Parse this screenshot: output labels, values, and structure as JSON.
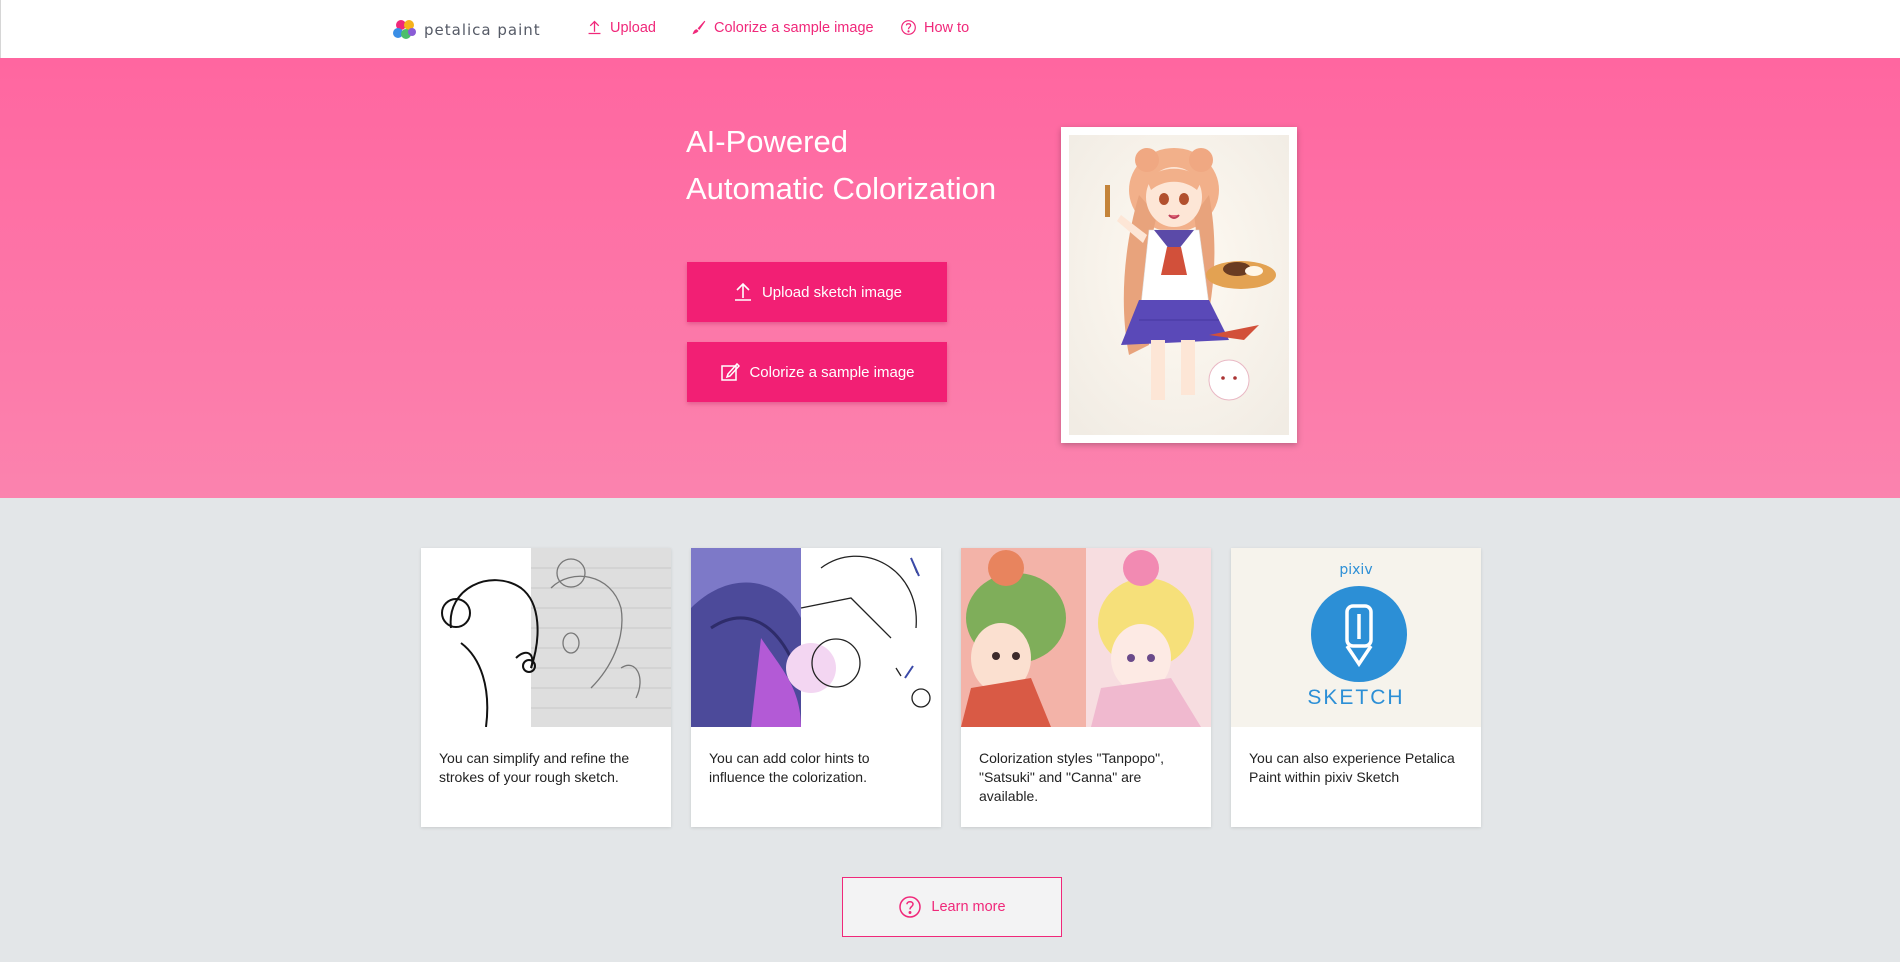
{
  "header": {
    "logo_text": "petalica paint",
    "nav": [
      {
        "label": "Upload",
        "icon": "upload-icon"
      },
      {
        "label": "Colorize a sample image",
        "icon": "brush-icon"
      },
      {
        "label": "How to",
        "icon": "question-circle-icon"
      }
    ]
  },
  "hero": {
    "title_line1": "AI-Powered",
    "title_line2": "Automatic Colorization",
    "upload_button": "Upload sketch image",
    "sample_button": "Colorize a sample image"
  },
  "features": [
    {
      "text": "You can simplify and refine the strokes of your rough sketch."
    },
    {
      "text": "You can add color hints to influence the colorization."
    },
    {
      "text": "Colorization styles \"Tanpopo\", \"Satsuki\" and \"Canna\" are available."
    },
    {
      "text": "You can also experience Petalica Paint within pixiv Sketch",
      "brand_small": "pixiv",
      "brand_big": "SKETCH"
    }
  ],
  "learn_more": "Learn more",
  "colors": {
    "accent": "#f0287a",
    "cta": "#f21f74",
    "hero_top": "#ff66a0",
    "hero_bottom": "#fb83ae",
    "page_bg": "#e3e6e8",
    "pixiv_blue": "#2c8fd6"
  }
}
